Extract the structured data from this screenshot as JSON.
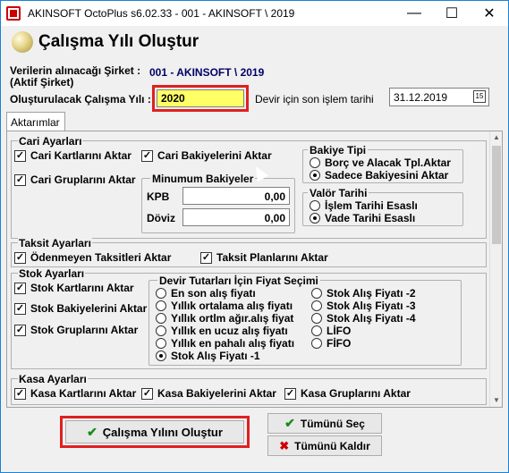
{
  "window": {
    "title": "AKINSOFT OctoPlus s6.02.33  -  001 - AKINSOFT \\ 2019",
    "minimize": "—",
    "maximize": "☐",
    "close": "✕"
  },
  "header": {
    "title": "Çalışma Yılı Oluştur"
  },
  "info": {
    "company_label": "Verilerin alınacağı Şirket :",
    "company_label2": "(Aktif Şirket)",
    "company_value": "001 - AKINSOFT \\ 2019",
    "year_label": "Oluşturulacak Çalışma Yılı :",
    "year_value": "2020",
    "date_label": "Devir için son işlem tarihi",
    "date_value": "31.12.2019",
    "calendar_icon": "15"
  },
  "tab": {
    "label": "Aktarımlar"
  },
  "cari": {
    "title": "Cari Ayarları",
    "kart": "Cari Kartlarını Aktar",
    "bakiye": "Cari Bakiyelerini Aktar",
    "grup": "Cari Gruplarını Aktar",
    "bakiye_tipi": {
      "title": "Bakiye Tipi",
      "opt1": "Borç ve Alacak Tpl.Aktar",
      "opt2": "Sadece Bakiyesini Aktar"
    },
    "min_bakiye": {
      "title": "Minumum Bakiyeler",
      "kpb_label": "KPB",
      "kpb_value": "0,00",
      "doviz_label": "Döviz",
      "doviz_value": "0,00"
    },
    "valor": {
      "title": "Valör Tarihi",
      "opt1": "İşlem Tarihi Esaslı",
      "opt2": "Vade Tarihi Esaslı"
    }
  },
  "taksit": {
    "title": "Taksit Ayarları",
    "odenmeyen": "Ödenmeyen Taksitleri Aktar",
    "plan": "Taksit Planlarını Aktar"
  },
  "stok": {
    "title": "Stok Ayarları",
    "kart": "Stok Kartlarını Aktar",
    "bakiye": "Stok Bakiyelerini Aktar",
    "grup": "Stok Gruplarını Aktar",
    "fiyat": {
      "title": "Devir Tutarları İçin Fiyat Seçimi",
      "left": [
        "En son alış fiyatı",
        "Yıllık ortalama alış fiyatı",
        "Yıllık ortlm ağır.alış fiyat",
        "Yıllık en ucuz alış fiyatı",
        "Yıllık en pahalı alış fiyatı",
        "Stok Alış Fiyatı -1"
      ],
      "right": [
        "Stok Alış Fiyatı -2",
        "Stok Alış Fiyatı -3",
        "Stok Alış Fiyatı -4",
        "LİFO",
        "FİFO"
      ]
    }
  },
  "kasa": {
    "title": "Kasa Ayarları",
    "kart": "Kasa Kartlarını Aktar",
    "bakiye": "Kasa Bakiyelerini Aktar",
    "grup": "Kasa Gruplarını Aktar"
  },
  "buttons": {
    "create": "Çalışma Yılını Oluştur",
    "select_all": "Tümünü Seç",
    "remove_all": "Tümünü Kaldır"
  },
  "colors": {
    "highlight_frame": "#e02020",
    "year_input_bg": "#ffff66",
    "window_border": "#1883d7"
  }
}
